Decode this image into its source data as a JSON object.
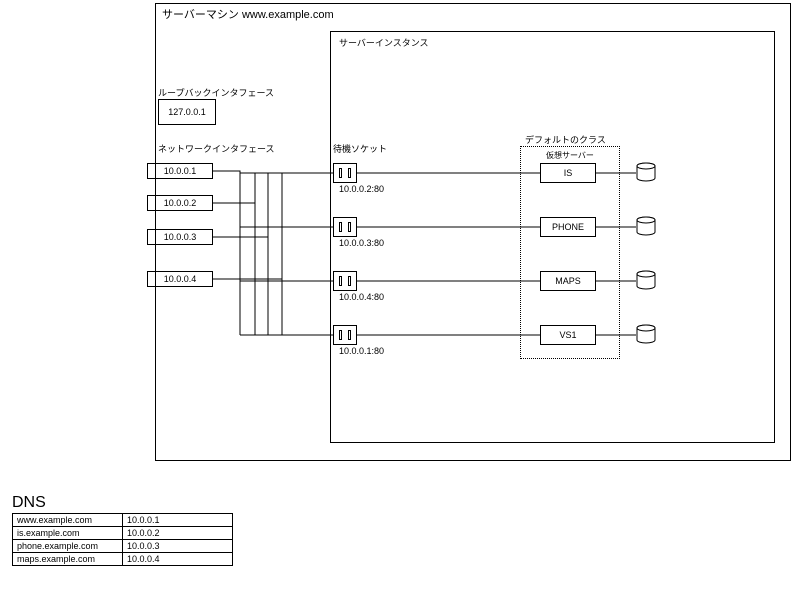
{
  "serverMachine": {
    "title": "サーバーマシン  www.example.com"
  },
  "serverInstance": {
    "title": "サーバーインスタンス"
  },
  "loopback": {
    "label": "ループバックインタフェース",
    "ip": "127.0.0.1"
  },
  "networkInterfaces": {
    "label": "ネットワークインタフェース",
    "items": [
      "10.0.0.1",
      "10.0.0.2",
      "10.0.0.3",
      "10.0.0.4"
    ]
  },
  "listenSockets": {
    "label": "待機ソケット",
    "items": [
      "10.0.0.2:80",
      "10.0.0.3:80",
      "10.0.0.4:80",
      "10.0.0.1:80"
    ]
  },
  "defaultClass": {
    "label": "デフォルトのクラス"
  },
  "virtualServers": {
    "label": "仮想サーバー",
    "items": [
      "IS",
      "PHONE",
      "MAPS",
      "VS1"
    ]
  },
  "dns": {
    "title": "DNS",
    "rows": [
      {
        "host": "www.example.com",
        "ip": "10.0.0.1"
      },
      {
        "host": "is.example.com",
        "ip": "10.0.0.2"
      },
      {
        "host": "phone.example.com",
        "ip": "10.0.0.3"
      },
      {
        "host": "maps.example.com",
        "ip": "10.0.0.4"
      }
    ]
  }
}
